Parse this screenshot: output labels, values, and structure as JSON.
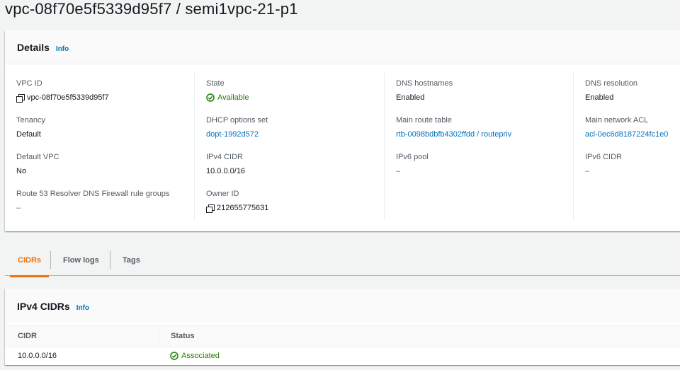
{
  "page": {
    "title": "vpc-08f70e5f5339d95f7 / semi1vpc-21-p1"
  },
  "details": {
    "title": "Details",
    "info_label": "Info",
    "fields": {
      "vpc_id": {
        "label": "VPC ID",
        "value": "vpc-08f70e5f5339d95f7"
      },
      "tenancy": {
        "label": "Tenancy",
        "value": "Default"
      },
      "default_vpc": {
        "label": "Default VPC",
        "value": "No"
      },
      "route53": {
        "label": "Route 53 Resolver DNS Firewall rule groups",
        "value": "–"
      },
      "state": {
        "label": "State",
        "value": "Available"
      },
      "dhcp": {
        "label": "DHCP options set",
        "value": "dopt-1992d572"
      },
      "ipv4_cidr": {
        "label": "IPv4 CIDR",
        "value": "10.0.0.0/16"
      },
      "owner_id": {
        "label": "Owner ID",
        "value": "212655775631"
      },
      "dns_hostnames": {
        "label": "DNS hostnames",
        "value": "Enabled"
      },
      "main_route_table": {
        "label": "Main route table",
        "value": "rtb-0098bdbfb4302ffdd / routepriv"
      },
      "ipv6_pool": {
        "label": "IPv6 pool",
        "value": "–"
      },
      "dns_resolution": {
        "label": "DNS resolution",
        "value": "Enabled"
      },
      "main_network_acl": {
        "label": "Main network ACL",
        "value": "acl-0ec6d8187224fc1e0"
      },
      "ipv6_cidr": {
        "label": "IPv6 CIDR",
        "value": "–"
      }
    }
  },
  "tabs": [
    {
      "label": "CIDRs",
      "active": true
    },
    {
      "label": "Flow logs",
      "active": false
    },
    {
      "label": "Tags",
      "active": false
    }
  ],
  "ipv4_cidrs": {
    "title": "IPv4 CIDRs",
    "info_label": "Info",
    "columns": [
      "CIDR",
      "Status"
    ],
    "rows": [
      {
        "cidr": "10.0.0.0/16",
        "status": "Associated"
      }
    ]
  },
  "colors": {
    "link": "#0073bb",
    "success": "#1d8102",
    "active_tab": "#ec7211"
  }
}
